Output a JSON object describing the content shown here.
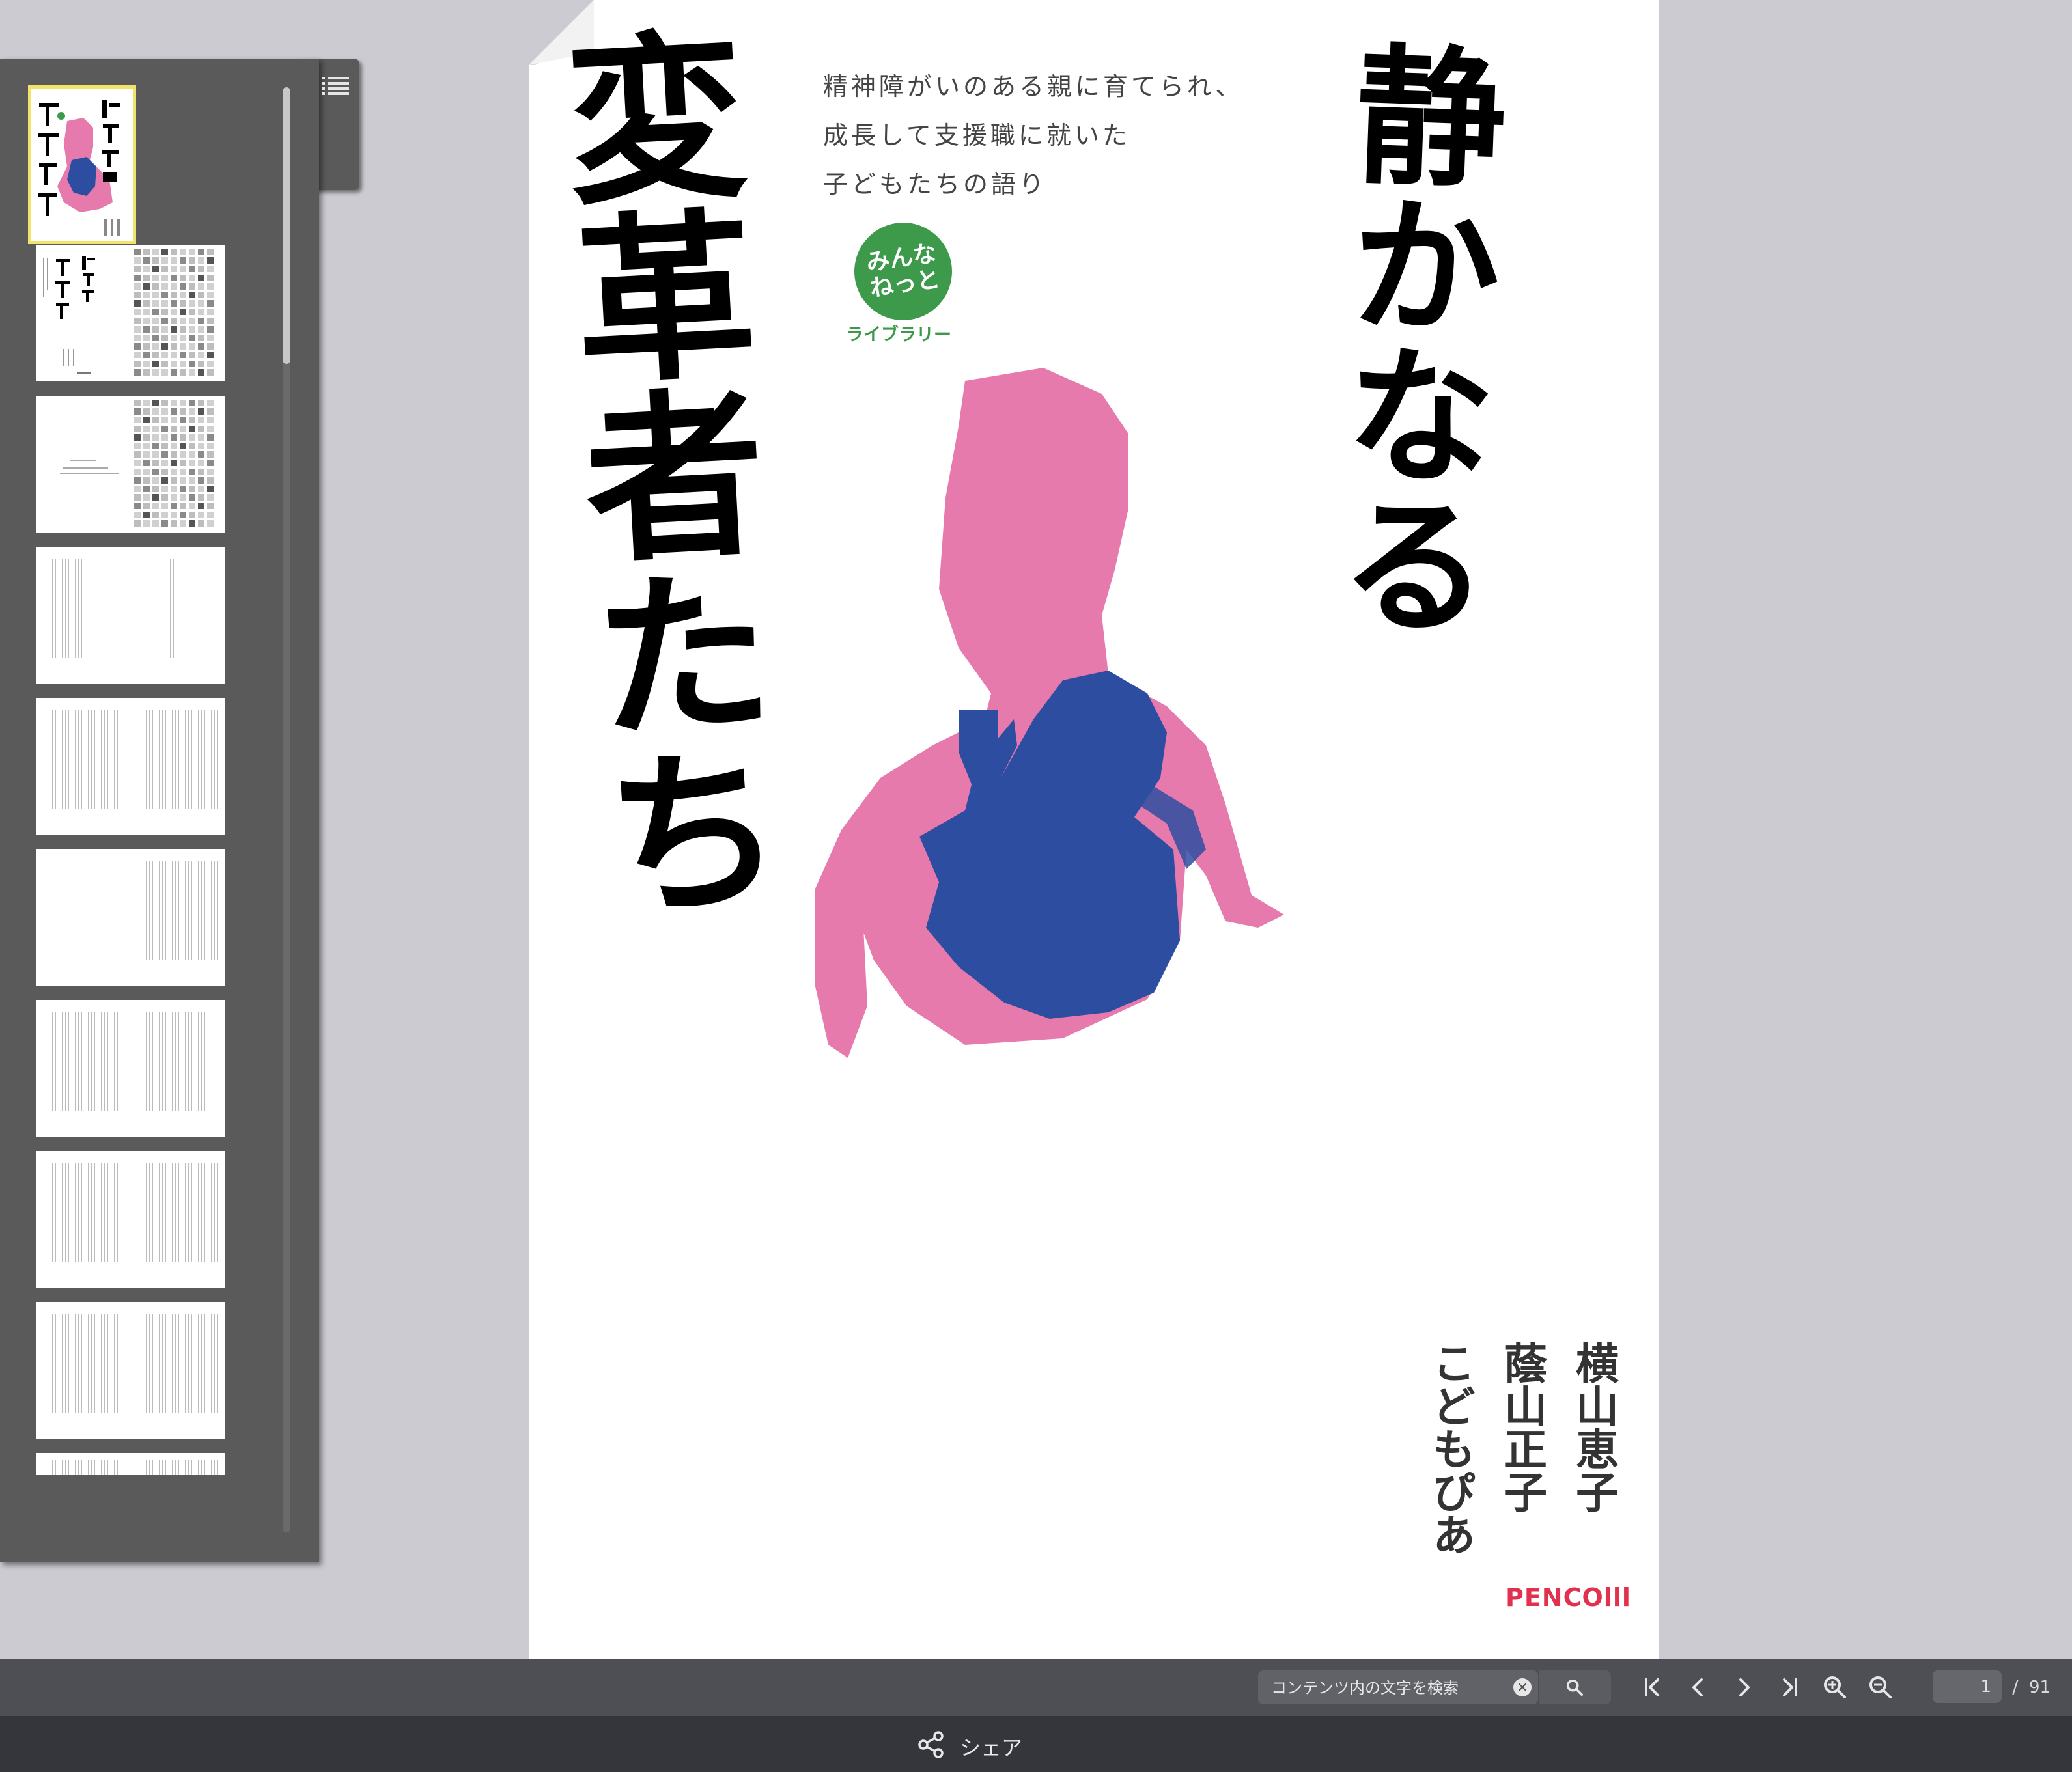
{
  "cover": {
    "subtitle_lines": [
      "精神障がいのある親に育てられ、",
      "成長して支援職に就いた",
      "子どもたちの語り"
    ],
    "badge_line1": "みんな",
    "badge_line2": "ねっと",
    "badge_sub": "ライブラリー",
    "title_part1": "静かなる",
    "title_part2": "変革者たち",
    "authors": [
      "横山恵子",
      "蔭山正子",
      "こどもぴあ"
    ],
    "publisher": "PENCOlll",
    "colors": {
      "pink": "#e77aac",
      "navy": "#2d4da0",
      "green": "#3d9a4a",
      "publisher_red": "#e0314f"
    }
  },
  "thumbnails": {
    "count_visible": 10,
    "active_index": 0
  },
  "toolbar": {
    "search_placeholder": "コンテンツ内の文字を検索",
    "current_page": "1",
    "page_separator": "/",
    "total_pages": "91"
  },
  "footer": {
    "share_label": "シェア"
  }
}
